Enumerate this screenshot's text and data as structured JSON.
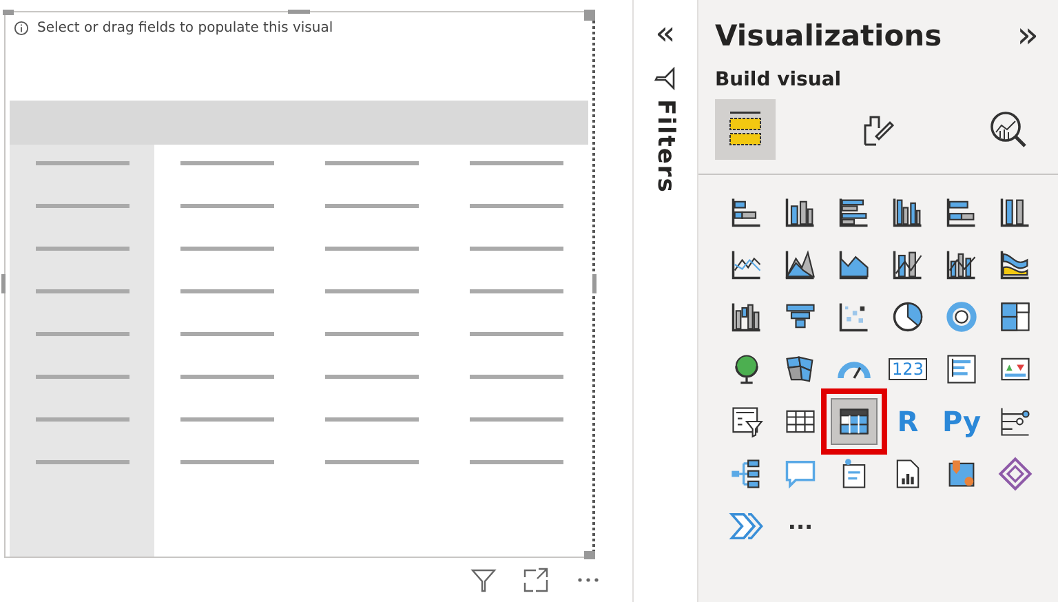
{
  "visual": {
    "hint": "Select or drag fields to populate this visual"
  },
  "filters_pane": {
    "collapse_glyph": "«",
    "title": "Filters"
  },
  "visualizations_pane": {
    "title": "Visualizations",
    "expand_glyph": "»",
    "subtitle": "Build visual",
    "tabs": [
      {
        "kind": "build",
        "selected": true
      },
      {
        "kind": "format",
        "selected": false
      },
      {
        "kind": "analytics",
        "selected": false
      }
    ],
    "icons": [
      {
        "kind": "stacked-bar",
        "selected": false
      },
      {
        "kind": "stacked-column",
        "selected": false
      },
      {
        "kind": "clustered-bar",
        "selected": false
      },
      {
        "kind": "clustered-column",
        "selected": false
      },
      {
        "kind": "percent-bar",
        "selected": false
      },
      {
        "kind": "percent-column",
        "selected": false
      },
      {
        "kind": "line",
        "selected": false
      },
      {
        "kind": "area",
        "selected": false
      },
      {
        "kind": "stacked-area",
        "selected": false
      },
      {
        "kind": "line-column",
        "selected": false
      },
      {
        "kind": "line-clustered",
        "selected": false
      },
      {
        "kind": "ribbon",
        "selected": false
      },
      {
        "kind": "waterfall",
        "selected": false
      },
      {
        "kind": "funnel",
        "selected": false
      },
      {
        "kind": "scatter",
        "selected": false
      },
      {
        "kind": "pie",
        "selected": false
      },
      {
        "kind": "donut",
        "selected": false
      },
      {
        "kind": "treemap",
        "selected": false
      },
      {
        "kind": "globe",
        "selected": false
      },
      {
        "kind": "filled-map",
        "selected": false
      },
      {
        "kind": "gauge",
        "selected": false
      },
      {
        "kind": "card",
        "text": "123",
        "selected": false
      },
      {
        "kind": "multirow-card",
        "selected": false
      },
      {
        "kind": "kpi",
        "selected": false
      },
      {
        "kind": "slicer",
        "selected": false
      },
      {
        "kind": "table",
        "selected": false
      },
      {
        "kind": "matrix",
        "selected": true
      },
      {
        "kind": "text-tile",
        "text": "R",
        "selected": false
      },
      {
        "kind": "text-tile",
        "text": "Py",
        "selected": false
      },
      {
        "kind": "influencers",
        "selected": false
      },
      {
        "kind": "decomposition",
        "selected": false
      },
      {
        "kind": "speech",
        "selected": false
      },
      {
        "kind": "narrative",
        "selected": false
      },
      {
        "kind": "report",
        "selected": false
      },
      {
        "kind": "azure-map",
        "selected": false
      },
      {
        "kind": "diamond",
        "selected": false
      },
      {
        "kind": "automate",
        "selected": false
      },
      {
        "kind": "text-tile",
        "text": "···",
        "selected": false
      }
    ]
  }
}
